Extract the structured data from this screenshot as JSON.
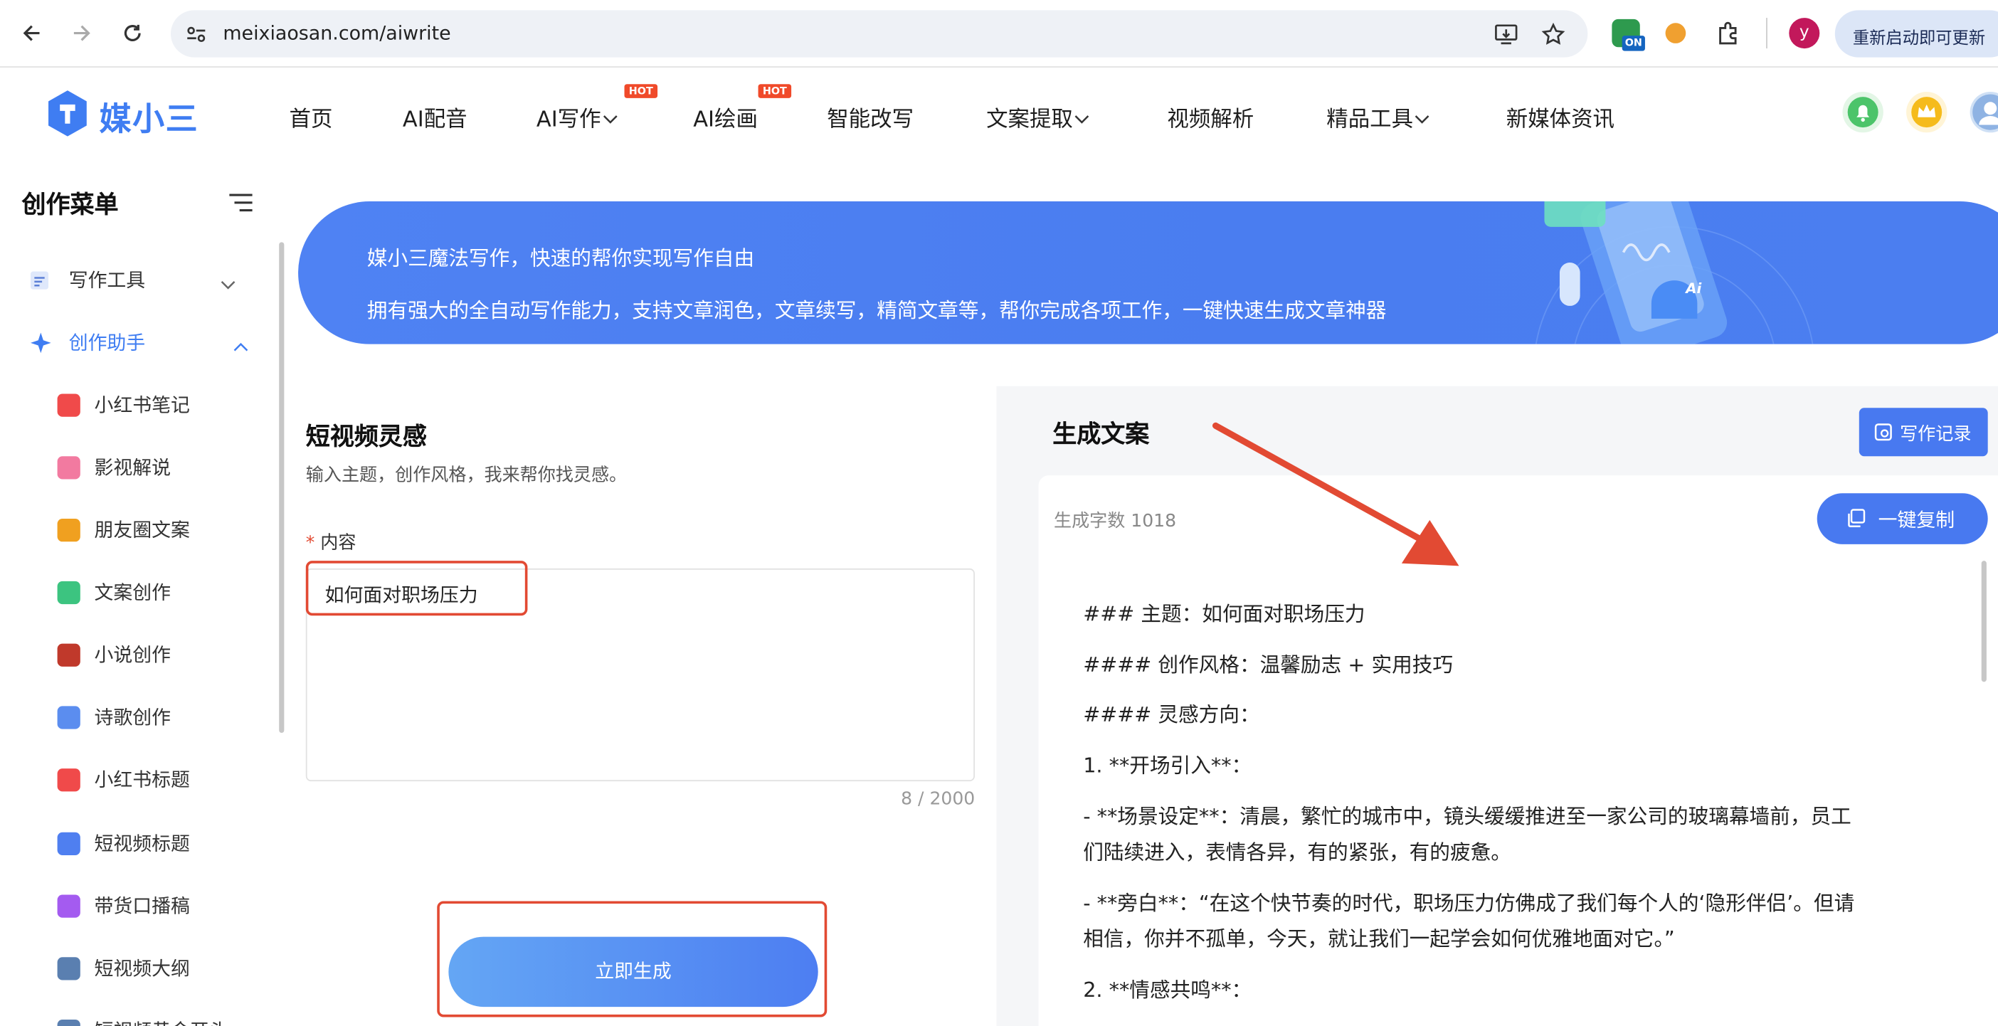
{
  "browser": {
    "url": "meixiaosan.com/aiwrite",
    "relaunch_label": "重新启动即可更新",
    "profile_initial": "y",
    "ext_badge": "ON"
  },
  "site": {
    "logo_text": "媒小三",
    "nav": [
      {
        "label": "首页"
      },
      {
        "label": "AI配音"
      },
      {
        "label": "AI写作",
        "badge": "HOT"
      },
      {
        "label": "AI绘画",
        "badge": "HOT"
      },
      {
        "label": "智能改写"
      },
      {
        "label": "文案提取"
      },
      {
        "label": "视频解析"
      },
      {
        "label": "精品工具"
      },
      {
        "label": "新媒体资讯"
      }
    ]
  },
  "sidebar": {
    "title": "创作菜单",
    "groups": [
      {
        "label": "写作工具"
      },
      {
        "label": "创作助手"
      }
    ],
    "items": [
      {
        "label": "小红书笔记",
        "icon": "xiaohongshu-icon",
        "color": "#f04a4a"
      },
      {
        "label": "影视解说",
        "icon": "video-icon",
        "color": "#f27aa0"
      },
      {
        "label": "朋友圈文案",
        "icon": "aperture-icon",
        "color": "#f0a020"
      },
      {
        "label": "文案创作",
        "icon": "bulb-icon",
        "color": "#3cc480"
      },
      {
        "label": "小说创作",
        "icon": "book-icon",
        "color": "#c0392b"
      },
      {
        "label": "诗歌创作",
        "icon": "poem-icon",
        "color": "#5b8def"
      },
      {
        "label": "小红书标题",
        "icon": "xiaohongshu-icon",
        "color": "#f04a4a"
      },
      {
        "label": "短视频标题",
        "icon": "short-video-icon",
        "color": "#4f7ff0"
      },
      {
        "label": "带货口播稿",
        "icon": "broadcast-icon",
        "color": "#a45bf0"
      },
      {
        "label": "短视频大纲",
        "icon": "outline-icon",
        "color": "#5a7fb0"
      },
      {
        "label": "短视频黄金开头",
        "icon": "short-video-icon",
        "color": "#5a7fb0"
      }
    ]
  },
  "banner": {
    "line1": "媒小三魔法写作，快速的帮你实现写作自由",
    "line2": "拥有强大的全自动写作能力，支持文章润色，文章续写，精简文章等，帮你完成各项工作，一键快速生成文章神器",
    "ai_badge": "Ai"
  },
  "form": {
    "title": "短视频灵感",
    "subtitle": "输入主题，创作风格，我来帮你找灵感。",
    "required_mark": "*",
    "field_label": "内容",
    "field_value": "如何面对职场压力",
    "counter": "8 / 2000",
    "submit_label": "立即生成"
  },
  "result": {
    "title": "生成文案",
    "record_label": "写作记录",
    "word_count": "生成字数 1018",
    "copy_label": "一键复制",
    "lines": [
      "### 主题：如何面对职场压力",
      "#### 创作风格：温馨励志 + 实用技巧",
      "#### 灵感方向：",
      "1. **开场引入**：",
      "- **场景设定**：清晨，繁忙的城市中，镜头缓缓推进至一家公司的玻璃幕墙前，员工",
      "们陆续进入，表情各异，有的紧张，有的疲惫。",
      "- **旁白**：“在这个快节奏的时代，职场压力仿佛成了我们每个人的‘隐形伴侣’。但请",
      "相信，你并不孤单，今天，就让我们一起学会如何优雅地面对它。”",
      "2. **情感共鸣**："
    ]
  }
}
